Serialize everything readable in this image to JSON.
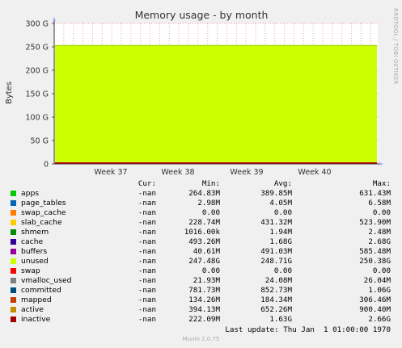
{
  "chart_data": {
    "type": "area",
    "title": "Memory usage - by month",
    "ylabel": "Bytes",
    "xlabel": "",
    "yticks": [
      "0",
      "50 G",
      "100 G",
      "150 G",
      "200 G",
      "250 G",
      "300 G"
    ],
    "yvalues_gb": [
      0,
      50,
      100,
      150,
      200,
      250,
      300
    ],
    "ylim_gb": [
      0,
      300
    ],
    "xticks": [
      "Week 37",
      "Week 38",
      "Week 39",
      "Week 40"
    ],
    "stack_top_gb": 253,
    "grid": true,
    "series_colors": {
      "unused": "#ccff00",
      "inactive": "#cc0000"
    }
  },
  "side_label": "RRDTOOL / TOBI OETIKER",
  "legend": {
    "headers": {
      "cur": "Cur:",
      "min": "Min:",
      "avg": "Avg:",
      "max": "Max:"
    },
    "rows": [
      {
        "name": "apps",
        "color": "#00cc00",
        "cur": "-nan",
        "min": "264.83M",
        "avg": "389.85M",
        "max": "631.43M"
      },
      {
        "name": "page_tables",
        "color": "#0066b3",
        "cur": "-nan",
        "min": "2.98M",
        "avg": "4.05M",
        "max": "6.58M"
      },
      {
        "name": "swap_cache",
        "color": "#ff8000",
        "cur": "-nan",
        "min": "0.00",
        "avg": "0.00",
        "max": "0.00"
      },
      {
        "name": "slab_cache",
        "color": "#ffcc00",
        "cur": "-nan",
        "min": "228.74M",
        "avg": "431.32M",
        "max": "523.90M"
      },
      {
        "name": "shmem",
        "color": "#008f00",
        "cur": "-nan",
        "min": "1016.00k",
        "avg": "1.94M",
        "max": "2.48M"
      },
      {
        "name": "cache",
        "color": "#330099",
        "cur": "-nan",
        "min": "493.26M",
        "avg": "1.68G",
        "max": "2.68G"
      },
      {
        "name": "buffers",
        "color": "#990099",
        "cur": "-nan",
        "min": "40.61M",
        "avg": "491.03M",
        "max": "585.48M"
      },
      {
        "name": "unused",
        "color": "#ccff00",
        "cur": "-nan",
        "min": "247.48G",
        "avg": "248.71G",
        "max": "250.38G"
      },
      {
        "name": "swap",
        "color": "#ff0000",
        "cur": "-nan",
        "min": "0.00",
        "avg": "0.00",
        "max": "0.00"
      },
      {
        "name": "vmalloc_used",
        "color": "#808080",
        "cur": "-nan",
        "min": "21.93M",
        "avg": "24.08M",
        "max": "26.04M"
      },
      {
        "name": "committed",
        "color": "#004d80",
        "cur": "-nan",
        "min": "781.73M",
        "avg": "852.73M",
        "max": "1.06G"
      },
      {
        "name": "mapped",
        "color": "#c04000",
        "cur": "-nan",
        "min": "134.26M",
        "avg": "184.34M",
        "max": "306.46M"
      },
      {
        "name": "active",
        "color": "#bf8f00",
        "cur": "-nan",
        "min": "394.13M",
        "avg": "652.26M",
        "max": "900.40M"
      },
      {
        "name": "inactive",
        "color": "#a00000",
        "cur": "-nan",
        "min": "222.09M",
        "avg": "1.63G",
        "max": "2.66G"
      }
    ]
  },
  "footer": {
    "last_update": "Last update: Thu Jan  1 01:00:00 1970",
    "munin_version": "Munin 2.0.75"
  }
}
